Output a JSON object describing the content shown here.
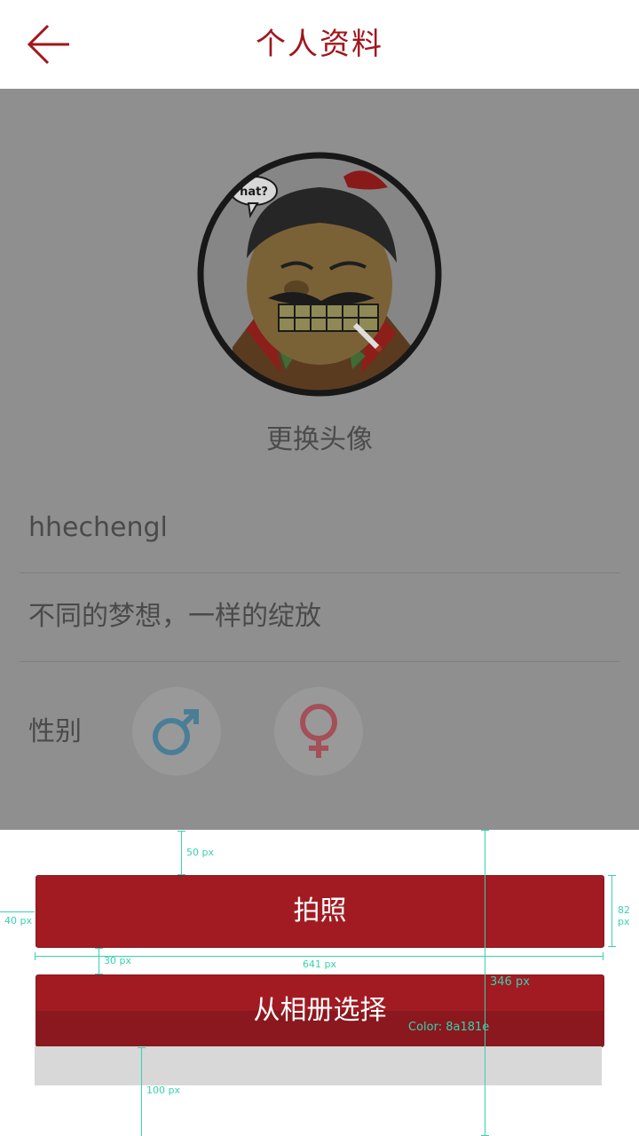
{
  "header": {
    "title": "个人资料",
    "back_icon": "arrow-left-icon",
    "accent_color": "#a2161c"
  },
  "profile": {
    "change_avatar_label": "更换头像",
    "username": "hhechengl",
    "signature": "不同的梦想，一样的绽放",
    "gender_label": "性别",
    "male_icon": "male-symbol-icon",
    "female_icon": "female-symbol-icon",
    "avatar_bubble_text": "hat?"
  },
  "sheet": {
    "camera_label": "拍照",
    "album_label": "从相册选择",
    "button_color": "#a21b22"
  },
  "annotations": {
    "top_gap": "50 px",
    "left_gap": "40 px",
    "button_height": "82 px",
    "button_gap": "30 px",
    "button_width": "641 px",
    "sheet_height": "346 px",
    "color_label": "Color:",
    "color_value": "8a181e",
    "bottom_gap": "100 px"
  }
}
